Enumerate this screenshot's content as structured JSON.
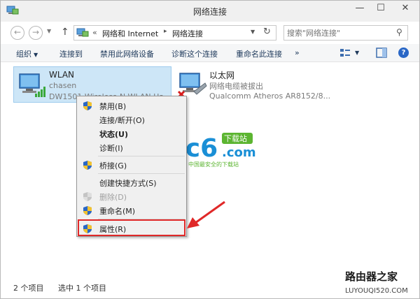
{
  "window": {
    "title": "网络连接",
    "controls": {
      "minimize": "—",
      "maximize": "☐",
      "close": "✕"
    }
  },
  "nav": {
    "back": "←",
    "forward": "→",
    "up": "↑",
    "address_chevron": "«",
    "breadcrumbs": [
      "网络和 Internet",
      "网络连接"
    ],
    "crumb_separator": "▸",
    "refresh": "↻",
    "search_placeholder": "搜索\"网络连接\""
  },
  "toolbar": {
    "items": [
      "组织",
      "连接到",
      "禁用此网络设备",
      "诊断这个连接",
      "重命名此连接",
      "»"
    ],
    "help": "?"
  },
  "connections": [
    {
      "name": "WLAN",
      "sub": "chasen",
      "device": "DW1501 Wireless-N WLAN Ha",
      "selected": true
    },
    {
      "name": "以太网",
      "sub": "网络电缆被拔出",
      "device": "Qualcomm Atheros AR8152/8...",
      "selected": false
    }
  ],
  "context_menu": {
    "items": [
      {
        "label": "禁用(B)",
        "icon": "shield-icon"
      },
      {
        "label": "连接/断开(O)",
        "icon": ""
      },
      {
        "label": "状态(U)",
        "icon": "",
        "bold": true
      },
      {
        "label": "诊断(I)",
        "icon": ""
      },
      {
        "label": "桥接(G)",
        "icon": "shield-icon"
      },
      {
        "label": "创建快捷方式(S)",
        "icon": ""
      },
      {
        "label": "删除(D)",
        "icon": "shield-icon",
        "disabled": true
      },
      {
        "label": "重命名(M)",
        "icon": "shield-icon"
      },
      {
        "label": "属性(R)",
        "icon": "shield-icon",
        "highlighted": true
      }
    ]
  },
  "status": {
    "count": "2 个项目",
    "selected": "选中 1 个项目"
  },
  "watermarks": {
    "pc6_main": "pc6",
    "pc6_badge": "下载站",
    "pc6_com": ".com",
    "pc6_tagline": "中国最安全的下载站",
    "luyou_zh": "路由器之家",
    "luyou_en": "LUYOUQI520.COM"
  },
  "colors": {
    "selection": "#cde6f7",
    "highlight_box": "#e02828",
    "arrow": "#e02828",
    "pc6_blue": "#1a8fd6",
    "pc6_green": "#5cb531"
  }
}
